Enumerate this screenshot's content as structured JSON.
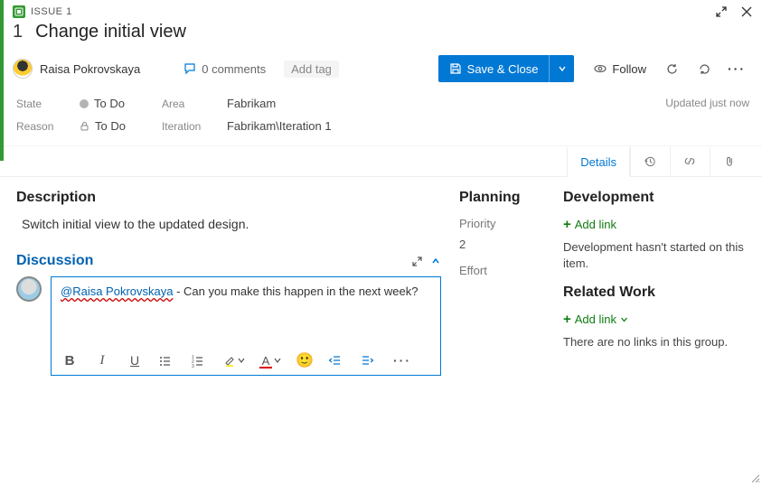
{
  "header": {
    "issue_label": "ISSUE 1",
    "issue_number": "1",
    "title": "Change initial view"
  },
  "assignee": {
    "name": "Raisa Pokrovskaya"
  },
  "toolbar": {
    "comments_label": "0 comments",
    "add_tag": "Add tag",
    "save_close": "Save & Close",
    "follow": "Follow"
  },
  "fields": {
    "state_label": "State",
    "state_value": "To Do",
    "reason_label": "Reason",
    "reason_value": "To Do",
    "area_label": "Area",
    "area_value": "Fabrikam",
    "iteration_label": "Iteration",
    "iteration_value": "Fabrikam\\Iteration 1",
    "updated": "Updated just now"
  },
  "tabs": {
    "details": "Details"
  },
  "description": {
    "heading": "Description",
    "body": "Switch initial view to the updated design."
  },
  "discussion": {
    "heading": "Discussion",
    "mention": "@Raisa Pokrovskaya",
    "text_after": " - Can you make this happen in the next week?"
  },
  "planning": {
    "heading": "Planning",
    "priority_label": "Priority",
    "priority_value": "2",
    "effort_label": "Effort"
  },
  "development": {
    "heading": "Development",
    "add_link": "Add link",
    "empty": "Development hasn't started on this item."
  },
  "related": {
    "heading": "Related Work",
    "add_link": "Add link",
    "empty": "There are no links in this group."
  }
}
